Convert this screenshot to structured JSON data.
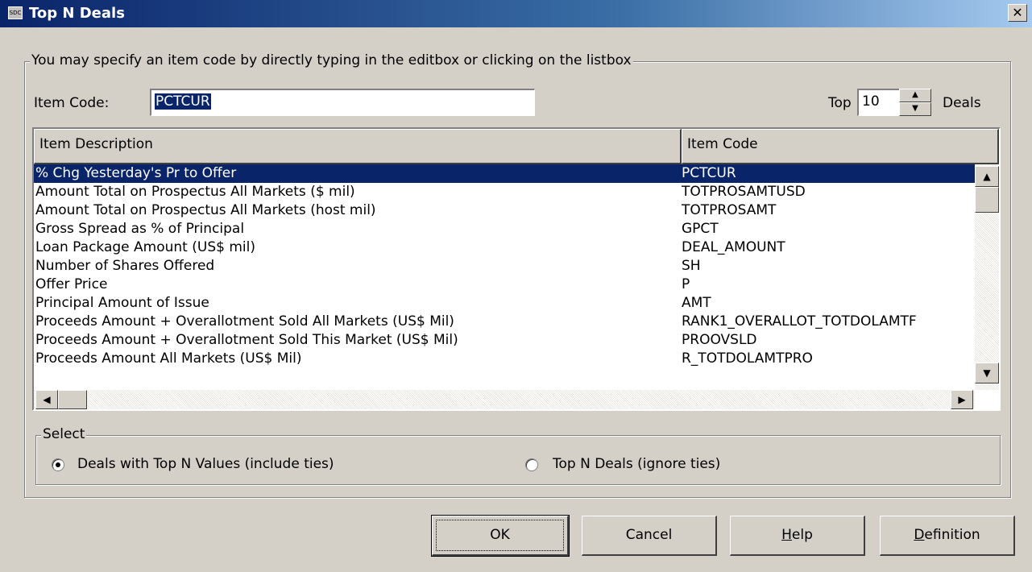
{
  "window": {
    "title": "Top N Deals",
    "app_icon_text": "SDC",
    "close_glyph": "✕"
  },
  "groupbox_main": {
    "legend": "You may specify an item code by directly typing in the editbox or clicking on the listbox"
  },
  "item_code": {
    "label": "Item Code:",
    "value": "PCTCUR"
  },
  "top_n": {
    "prefix": "Top",
    "value": "10",
    "suffix": "Deals"
  },
  "list": {
    "columns": [
      "Item Description",
      "Item Code"
    ],
    "rows": [
      {
        "desc": "% Chg Yesterday's Pr to Offer",
        "code": "PCTCUR",
        "selected": true
      },
      {
        "desc": "Amount Total on Prospectus All Markets ($ mil)",
        "code": "TOTPROSAMTUSD"
      },
      {
        "desc": "Amount Total on Prospectus All Markets (host mil)",
        "code": "TOTPROSAMT"
      },
      {
        "desc": "Gross Spread as % of Principal",
        "code": "GPCT"
      },
      {
        "desc": "Loan Package Amount (US$ mil)",
        "code": "DEAL_AMOUNT"
      },
      {
        "desc": "Number of Shares Offered",
        "code": "SH"
      },
      {
        "desc": "Offer Price",
        "code": "P"
      },
      {
        "desc": "Principal Amount of Issue",
        "code": "AMT"
      },
      {
        "desc": "Proceeds Amount + Overallotment Sold All Markets (US$ Mil)",
        "code": "RANK1_OVERALLOT_TOTDOLAMTF"
      },
      {
        "desc": "Proceeds Amount + Overallotment Sold This Market (US$ Mil)",
        "code": "PROOVSLD"
      },
      {
        "desc": "Proceeds Amount All Markets (US$ Mil)",
        "code": "R_TOTDOLAMTPRO"
      }
    ]
  },
  "select_group": {
    "legend": "Select",
    "option1": "Deals with Top N Values (include ties)",
    "option2": "Top N Deals (ignore ties)",
    "selected": "option1"
  },
  "buttons": {
    "ok": "OK",
    "cancel": "Cancel",
    "help_mnemonic": "H",
    "help_rest": "elp",
    "definition_mnemonic": "D",
    "definition_rest": "efinition"
  },
  "icons": {
    "scroll_up": "▲",
    "scroll_down": "▼",
    "scroll_left": "◀",
    "scroll_right": "▶"
  }
}
